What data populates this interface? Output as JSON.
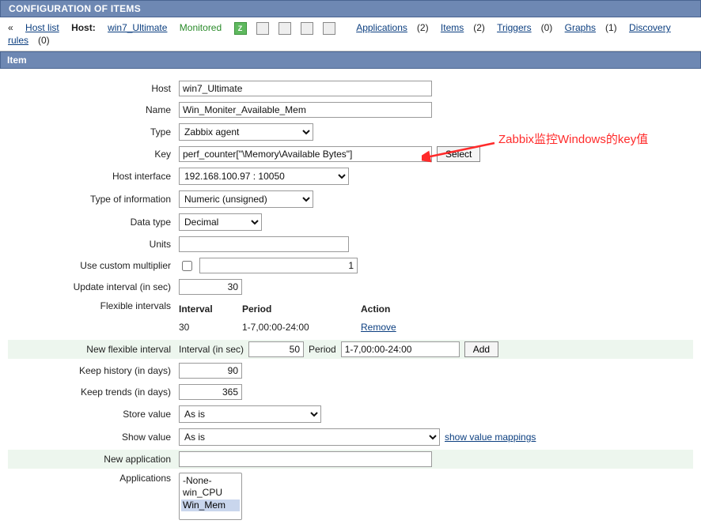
{
  "header": {
    "title": "CONFIGURATION OF ITEMS"
  },
  "nav": {
    "back": "Host list",
    "host_label": "Host:",
    "host_name": "win7_Ultimate",
    "monitored": "Monitored",
    "applications": "Applications",
    "applications_count": "(2)",
    "items": "Items",
    "items_count": "(2)",
    "triggers": "Triggers",
    "triggers_count": "(0)",
    "graphs": "Graphs",
    "graphs_count": "(1)",
    "discovery": "Discovery rules",
    "discovery_count": "(0)"
  },
  "section": {
    "title": "Item"
  },
  "form": {
    "host": {
      "label": "Host",
      "value": "win7_Ultimate"
    },
    "name": {
      "label": "Name",
      "value": "Win_Moniter_Available_Mem"
    },
    "type": {
      "label": "Type",
      "value": "Zabbix agent"
    },
    "key": {
      "label": "Key",
      "value": "perf_counter[\"\\Memory\\Available Bytes\"]",
      "select_btn": "Select"
    },
    "host_interface": {
      "label": "Host interface",
      "value": "192.168.100.97 : 10050"
    },
    "info_type": {
      "label": "Type of information",
      "value": "Numeric (unsigned)"
    },
    "data_type": {
      "label": "Data type",
      "value": "Decimal"
    },
    "units": {
      "label": "Units",
      "value": ""
    },
    "custom_mult": {
      "label": "Use custom multiplier",
      "value": "1"
    },
    "update_interval": {
      "label": "Update interval (in sec)",
      "value": "30"
    },
    "flex_intervals": {
      "label": "Flexible intervals",
      "head_interval": "Interval",
      "head_period": "Period",
      "head_action": "Action",
      "row_interval": "30",
      "row_period": "1-7,00:00-24:00",
      "row_action": "Remove"
    },
    "new_flex": {
      "label": "New flexible interval",
      "interval_label": "Interval (in sec)",
      "interval_value": "50",
      "period_label": "Period",
      "period_value": "1-7,00:00-24:00",
      "add_btn": "Add"
    },
    "keep_history": {
      "label": "Keep history (in days)",
      "value": "90"
    },
    "keep_trends": {
      "label": "Keep trends (in days)",
      "value": "365"
    },
    "store_value": {
      "label": "Store value",
      "value": "As is"
    },
    "show_value": {
      "label": "Show value",
      "value": "As is",
      "link": "show value mappings"
    },
    "new_application": {
      "label": "New application",
      "value": ""
    },
    "applications": {
      "label": "Applications",
      "options": [
        "-None-",
        "win_CPU",
        "Win_Mem"
      ],
      "selected": "Win_Mem"
    }
  },
  "annotation": {
    "text": "Zabbix监控Windows的key值"
  }
}
